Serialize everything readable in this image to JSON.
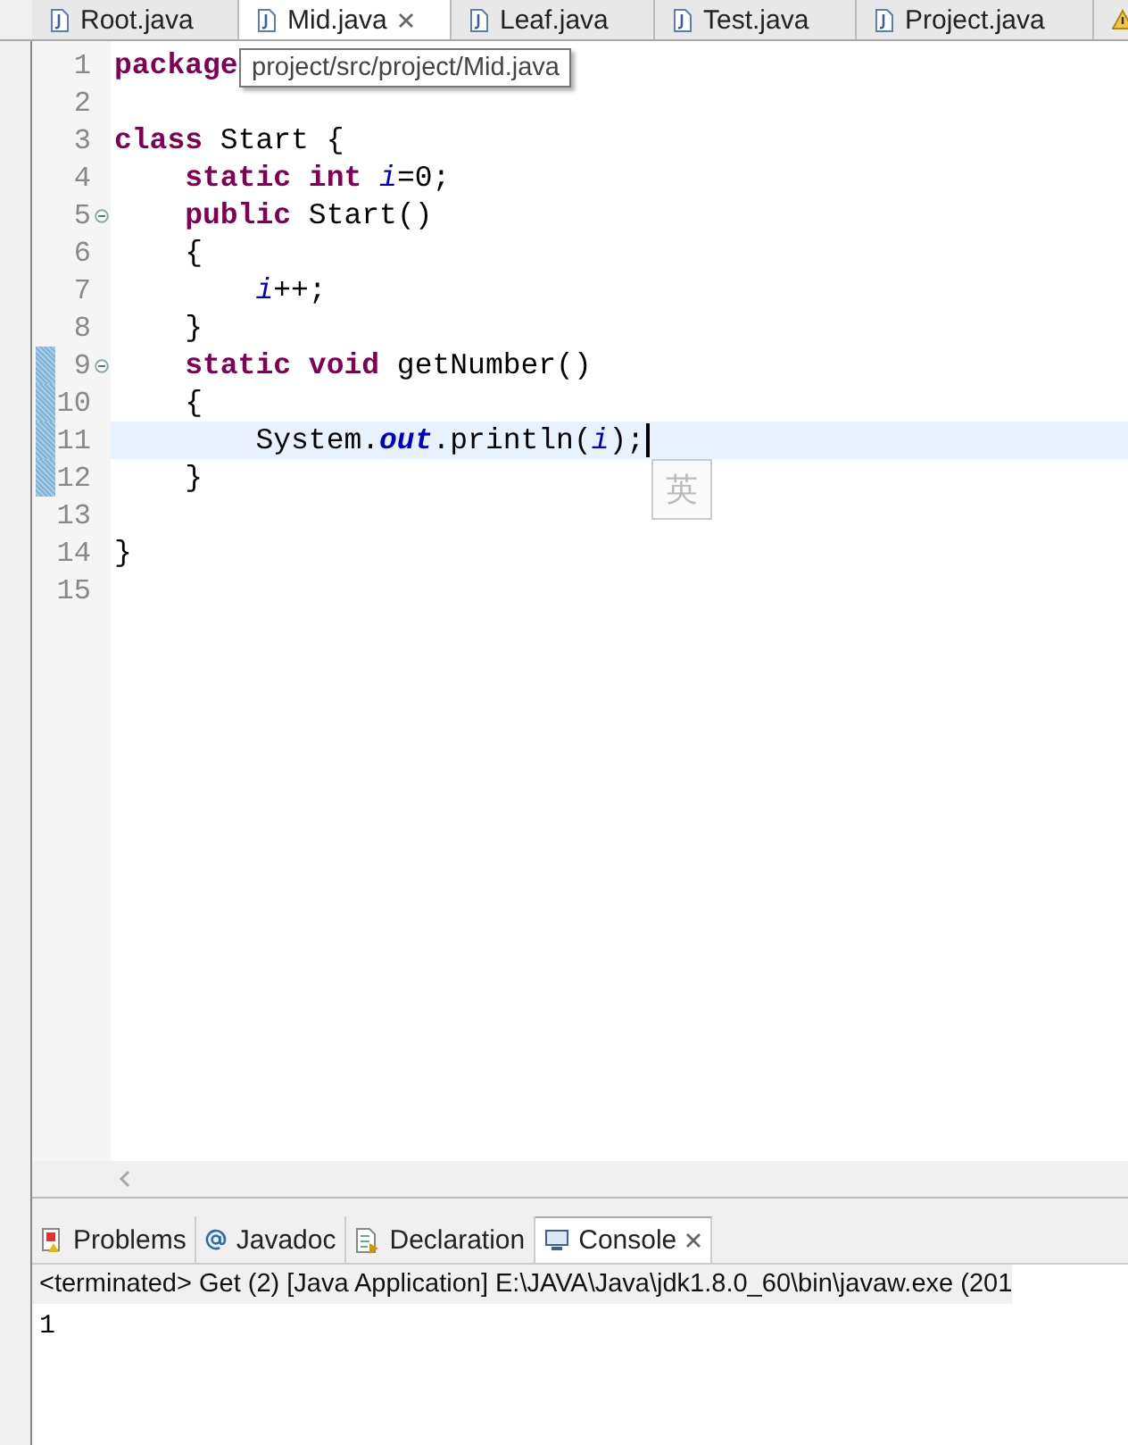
{
  "editor_tabs": [
    {
      "label": "Root.java",
      "selected": false,
      "closable": false,
      "kind": "java"
    },
    {
      "label": "Mid.java",
      "selected": true,
      "closable": true,
      "kind": "java"
    },
    {
      "label": "Leaf.java",
      "selected": false,
      "closable": false,
      "kind": "java"
    },
    {
      "label": "Test.java",
      "selected": false,
      "closable": false,
      "kind": "java"
    },
    {
      "label": "Project.java",
      "selected": false,
      "closable": false,
      "kind": "java"
    },
    {
      "selected": false,
      "closable": false,
      "kind": "warning"
    }
  ],
  "code_lines": [
    {
      "number": "1",
      "fold": false,
      "changed": false,
      "current": false,
      "tokens": [
        {
          "kind": "keyword",
          "text": "package"
        }
      ]
    },
    {
      "number": "2",
      "fold": false,
      "changed": false,
      "current": false
    },
    {
      "number": "3",
      "fold": false,
      "changed": false,
      "current": false,
      "tokens": [
        {
          "kind": "keyword",
          "text": "class"
        },
        {
          "kind": "plain",
          "text": " Start {"
        }
      ]
    },
    {
      "number": "4",
      "fold": false,
      "changed": false,
      "current": false,
      "tokens": [
        {
          "kind": "keyword",
          "text": "    static int "
        },
        {
          "kind": "field",
          "text": "i"
        },
        {
          "kind": "plain",
          "text": "=0;"
        }
      ]
    },
    {
      "number": "5",
      "fold": true,
      "changed": false,
      "current": false,
      "tokens": [
        {
          "kind": "keyword",
          "text": "    public"
        },
        {
          "kind": "plain",
          "text": " Start()"
        }
      ]
    },
    {
      "number": "6",
      "fold": false,
      "changed": false,
      "current": false,
      "tokens": [
        {
          "kind": "plain",
          "text": "    {"
        }
      ]
    },
    {
      "number": "7",
      "fold": false,
      "changed": false,
      "current": false,
      "tokens": [
        {
          "kind": "field",
          "text": "        i"
        },
        {
          "kind": "plain",
          "text": "++;"
        }
      ]
    },
    {
      "number": "8",
      "fold": false,
      "changed": false,
      "current": false,
      "tokens": [
        {
          "kind": "plain",
          "text": "    }"
        }
      ]
    },
    {
      "number": "9",
      "fold": true,
      "changed": true,
      "current": false,
      "tokens": [
        {
          "kind": "keyword",
          "text": "    static void"
        },
        {
          "kind": "plain",
          "text": " getNumber()"
        }
      ]
    },
    {
      "number": "10",
      "fold": false,
      "changed": true,
      "current": false,
      "tokens": [
        {
          "kind": "plain",
          "text": "    {"
        }
      ]
    },
    {
      "number": "11",
      "fold": false,
      "changed": true,
      "current": true,
      "tokens": [
        {
          "kind": "plain",
          "text": "        System."
        },
        {
          "kind": "static_field",
          "text": "out"
        },
        {
          "kind": "plain",
          "text": ".println("
        },
        {
          "kind": "field",
          "text": "i"
        },
        {
          "kind": "plain",
          "text": ");"
        }
      ]
    },
    {
      "number": "12",
      "fold": false,
      "changed": true,
      "current": false,
      "tokens": [
        {
          "kind": "plain",
          "text": "    }"
        }
      ]
    },
    {
      "number": "13",
      "fold": false,
      "changed": false,
      "current": false
    },
    {
      "number": "14",
      "fold": false,
      "changed": false,
      "current": false,
      "tokens": [
        {
          "kind": "plain",
          "text": "}"
        }
      ]
    },
    {
      "number": "15",
      "fold": false,
      "changed": false,
      "current": false
    }
  ],
  "tooltip": "project/src/project/Mid.java",
  "ime_indicator": "英",
  "bottom_tabs": [
    {
      "label": "Problems",
      "selected": false,
      "closable": false,
      "kind": "problems"
    },
    {
      "label": "Javadoc",
      "selected": false,
      "closable": false,
      "kind": "javadoc"
    },
    {
      "label": "Declaration",
      "selected": false,
      "closable": false,
      "kind": "declaration"
    },
    {
      "label": "Console",
      "selected": true,
      "closable": true,
      "kind": "console"
    }
  ],
  "console": {
    "header": "<terminated> Get (2) [Java Application] E:\\JAVA\\Java\\jdk1.8.0_60\\bin\\javaw.exe (201",
    "output": "1"
  }
}
